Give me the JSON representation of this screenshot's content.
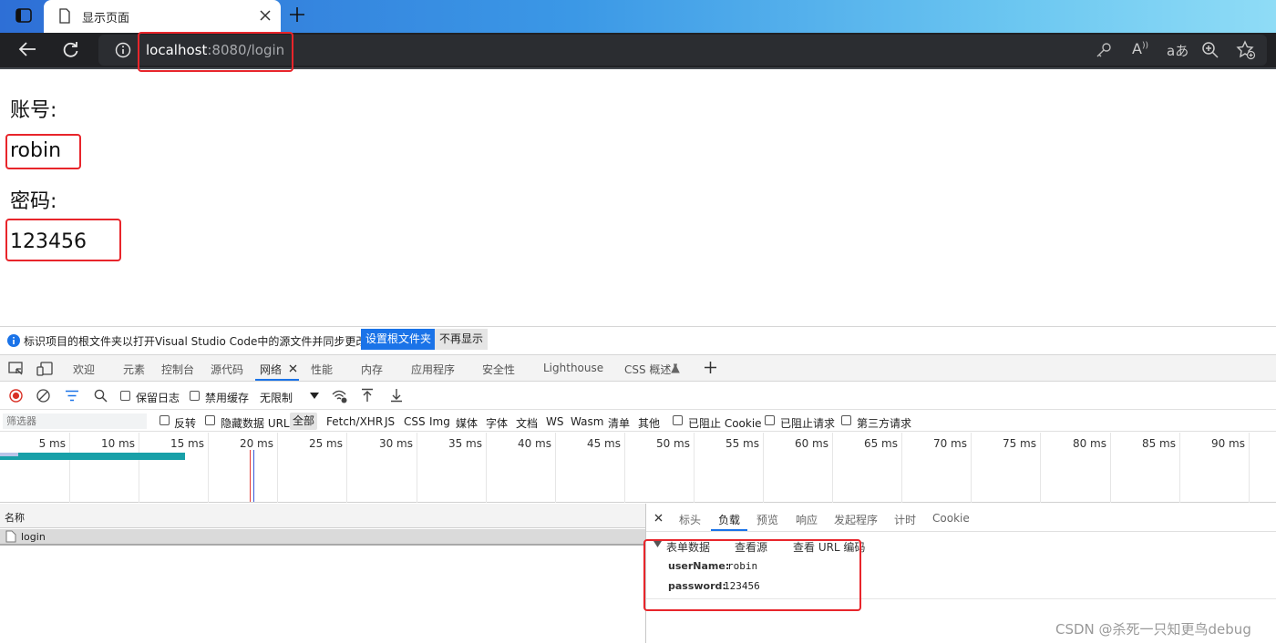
{
  "browser": {
    "tab_title": "显示页面",
    "url_host": "localhost",
    "url_path": ":8080/login"
  },
  "page": {
    "account_label": "账号:",
    "account_value": "robin",
    "password_label": "密码:",
    "password_value": "123456"
  },
  "infobar": {
    "message": "标识项目的根文件夹以打开Visual Studio Code中的源文件并同步更改。",
    "primary_button": "设置根文件夹",
    "secondary_button": "不再显示"
  },
  "devtools_tabs": [
    "欢迎",
    "元素",
    "控制台",
    "源代码",
    "网络",
    "性能",
    "内存",
    "应用程序",
    "安全性",
    "Lighthouse",
    "CSS 概述"
  ],
  "toolbar": {
    "preserve_log": "保留日志",
    "disable_cache": "禁用缓存",
    "throttling": "无限制"
  },
  "filter": {
    "placeholder": "筛选器",
    "invert": "反转",
    "hide_data_urls": "隐藏数据 URL",
    "types": [
      "全部",
      "Fetch/XHR",
      "JS",
      "CSS",
      "Img",
      "媒体",
      "字体",
      "文档",
      "WS",
      "Wasm",
      "清单",
      "其他"
    ],
    "blocked_cookies": "已阻止 Cookie",
    "blocked_requests": "已阻止请求",
    "third_party": "第三方请求"
  },
  "timeline": {
    "ticks": [
      "5 ms",
      "10 ms",
      "15 ms",
      "20 ms",
      "25 ms",
      "30 ms",
      "35 ms",
      "40 ms",
      "45 ms",
      "50 ms",
      "55 ms",
      "60 ms",
      "65 ms",
      "70 ms",
      "75 ms",
      "80 ms",
      "85 ms",
      "90 ms"
    ]
  },
  "requests": {
    "column_name": "名称",
    "rows": [
      "login"
    ]
  },
  "detail": {
    "tabs": [
      "标头",
      "负载",
      "预览",
      "响应",
      "发起程序",
      "计时",
      "Cookie"
    ],
    "section_title": "表单数据",
    "view_source": "查看源",
    "view_url_encoded": "查看 URL 编码",
    "fields": [
      {
        "key": "userName:",
        "value": "robin"
      },
      {
        "key": "password:",
        "value": "123456"
      }
    ]
  },
  "watermark": "CSDN @杀死一只知更鸟debug",
  "colors": {
    "accent": "#1a73e8",
    "highlight_box": "#e8252b",
    "record_stop": "#d93025"
  }
}
